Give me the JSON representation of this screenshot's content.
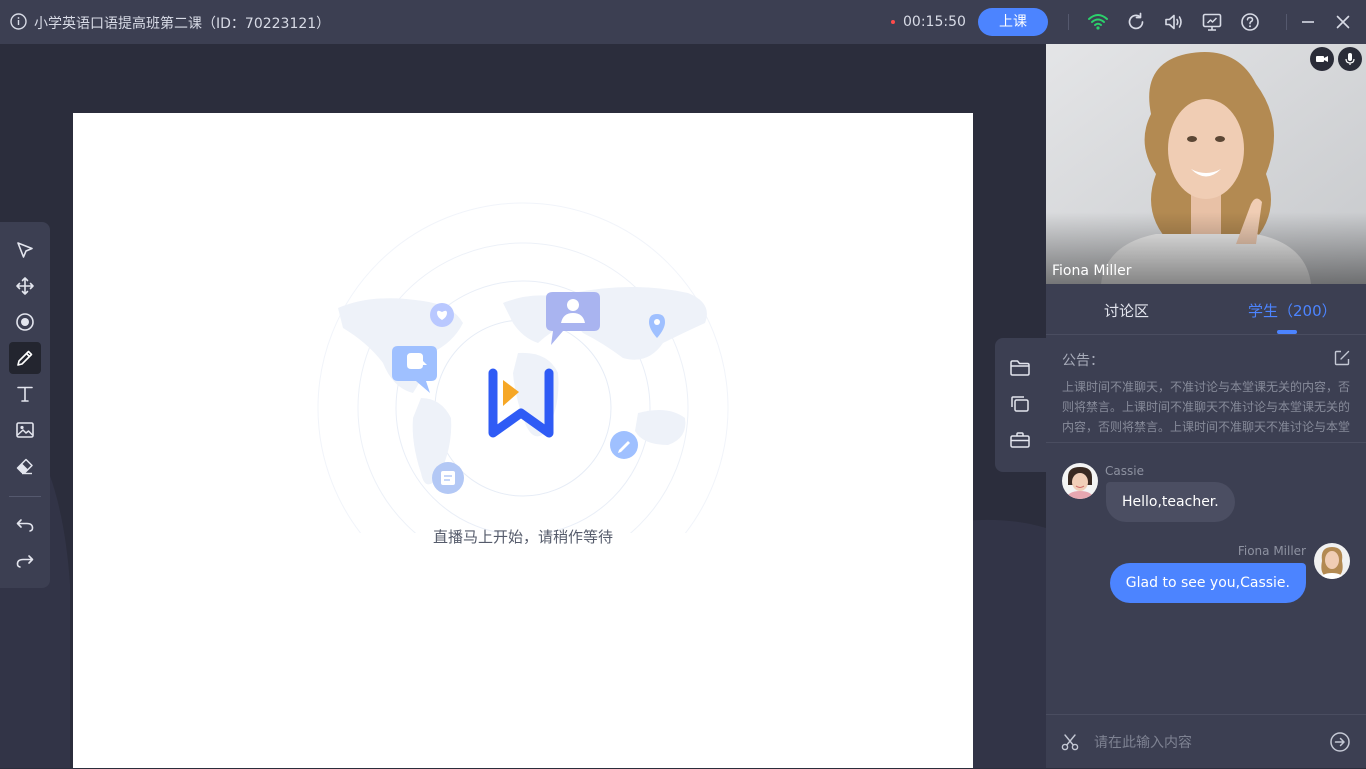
{
  "window": {
    "title": "小学英语口语提高班第二课（ID：70223121）",
    "timer": "00:15:50",
    "start_class_label": "上课"
  },
  "stage": {
    "waiting_text": "直播马上开始，请稍作等待"
  },
  "video": {
    "teacher_name": "Fiona Miller"
  },
  "tabs": {
    "discussion": "讨论区",
    "students": "学生（200）"
  },
  "notice": {
    "title": "公告：",
    "text": "上课时间不准聊天，不准讨论与本堂课无关的内容，否则将禁言。上课时间不准聊天不准讨论与本堂课无关的内容，否则将禁言。上课时间不准聊天不准讨论与本堂课无关的内容，否则将禁言。"
  },
  "messages": [
    {
      "sender": "Cassie",
      "text": "Hello,teacher."
    },
    {
      "sender": "Fiona Miller",
      "text": "Glad to see you,Cassie."
    }
  ],
  "chat_input": {
    "placeholder": "请在此输入内容"
  },
  "colors": {
    "accent": "#4c84ff",
    "topbar": "#3c3f52",
    "background": "#2b2d3c",
    "recording_dot": "#ff4b4b",
    "wifi": "#2bd16b"
  },
  "icons": {
    "toolbar": [
      "cursor-icon",
      "move-icon",
      "laser-pointer-icon",
      "pen-icon",
      "text-icon",
      "image-icon",
      "eraser-icon",
      "undo-icon",
      "redo-icon"
    ],
    "side": [
      "folder-icon",
      "copy-icon",
      "toolbox-icon"
    ],
    "topbar": [
      "wifi-icon",
      "refresh-icon",
      "volume-icon",
      "screen-share-icon",
      "help-icon",
      "minimize-icon",
      "close-icon"
    ]
  }
}
